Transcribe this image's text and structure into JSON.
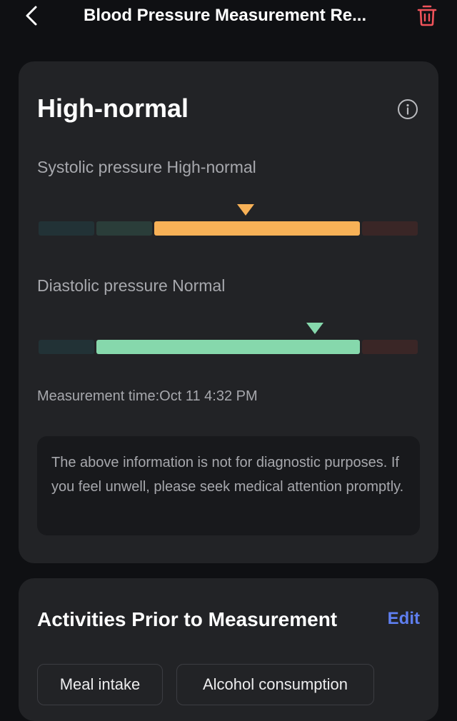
{
  "header": {
    "title": "Blood Pressure Measurement Re...",
    "back_icon": "chevron-left-icon",
    "delete_icon": "trash-icon",
    "delete_color": "#f0535a"
  },
  "result": {
    "status": "High-normal",
    "info_icon": "info-icon",
    "systolic": {
      "label": "Systolic pressure High-normal",
      "active_segment": "high-normal",
      "marker_position": 0.55,
      "active_color": "#f7b157"
    },
    "diastolic": {
      "label": "Diastolic pressure Normal",
      "active_segment": "normal",
      "marker_position": 0.73,
      "active_color": "#86d8ac"
    },
    "measurement_time": "Measurement time:Oct 11 4:32 PM",
    "disclaimer": "The above information is not for diagnostic purposes. If you feel unwell, please seek medical attention promptly."
  },
  "activities": {
    "title": "Activities Prior to Measurement",
    "edit_label": "Edit",
    "accent_color": "#5f7ff0",
    "items": [
      "Meal intake",
      "Alcohol consumption"
    ]
  }
}
